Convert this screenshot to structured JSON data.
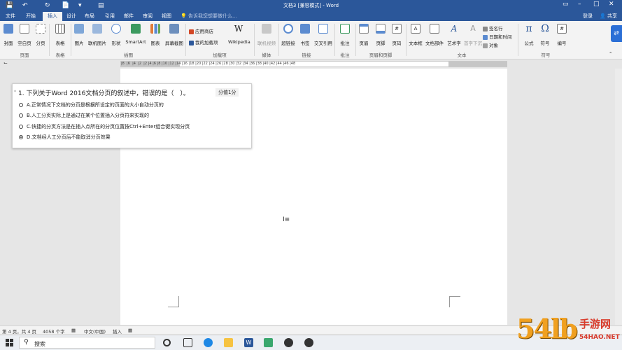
{
  "title": "文档3 [兼容模式] - Word",
  "tabs": [
    "文件",
    "开始",
    "插入",
    "设计",
    "布局",
    "引用",
    "邮件",
    "审阅",
    "视图"
  ],
  "active_tab": "插入",
  "tell_me": "告诉我您想要做什么...",
  "login": "登录",
  "share": "共享",
  "ribbon": {
    "buttons": [
      "封面",
      "空白页",
      "分页",
      "表格",
      "图片",
      "联机图片",
      "形状",
      "SmartArt",
      "图表",
      "屏幕截图",
      "Wikipedia",
      "联机视频",
      "超链接",
      "书签",
      "交叉引用",
      "批注",
      "页眉",
      "页脚",
      "页码",
      "文本框",
      "文档部件",
      "艺术字",
      "首字下沉",
      "公式",
      "符号",
      "编号"
    ],
    "small": [
      "应用商店",
      "我的加载项",
      "签名行",
      "日期和时间",
      "对象"
    ],
    "groups": [
      "页面",
      "表格",
      "插图",
      "加载项",
      "媒体",
      "链接",
      "批注",
      "页眉和页脚",
      "文本",
      "符号"
    ]
  },
  "quiz": {
    "star": "*",
    "question": "1. 下列关于Word 2016文档分页的叙述中，错误的是（　）。",
    "score": "分值1分",
    "options": [
      {
        "label": "A.正常情况下文档的分页是根据所设定的页面的大小自动分页的",
        "selected": false
      },
      {
        "label": "B.人工分页实际上是通过在某个位置插入分页符来实现的",
        "selected": false
      },
      {
        "label": "C.快捷的分页方法是在插入点所在的分页位置按Ctrl+Enter组合键实现分页",
        "selected": false
      },
      {
        "label": "D.文档经人工分页后不能取消分页效果",
        "selected": true
      }
    ]
  },
  "status": {
    "page": "第 4 页，共 4 页",
    "words": "4058 个字",
    "lang": "中文(中国)",
    "mode": "插入"
  },
  "taskbar": {
    "search": "搜索"
  },
  "watermark": {
    "number": "54lb",
    "text": "手游网",
    "url": "54HAO.NET"
  }
}
